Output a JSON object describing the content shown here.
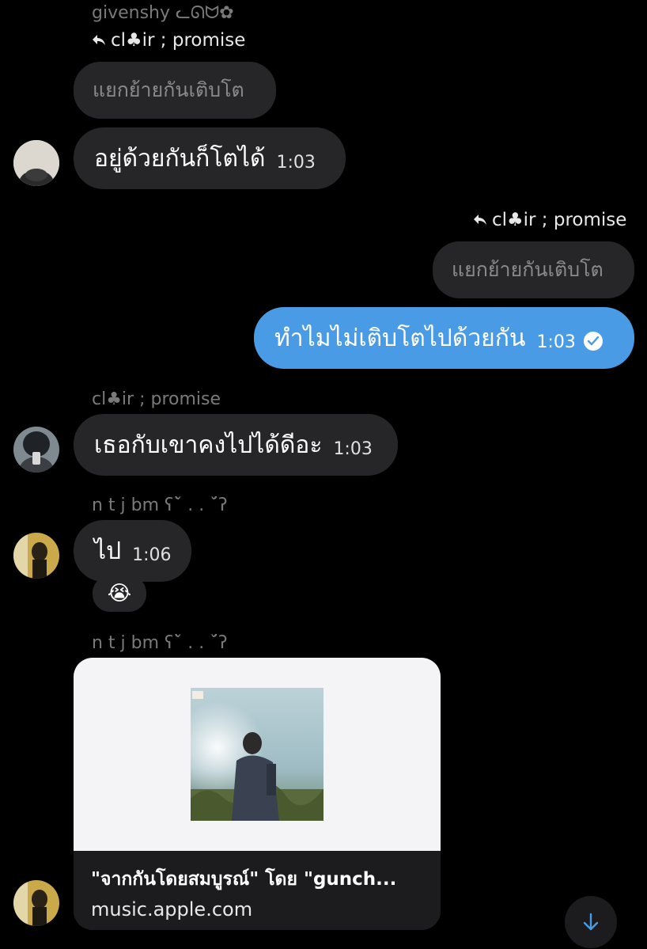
{
  "messages": {
    "m1": {
      "sender": "givenshy ᓚᘏᗢ✿",
      "reply_to": "cl♣ir ; promise",
      "quoted_text": "แยกย้ายกันเติบโต",
      "text": "อยู่ด้วยกันก็โตได้",
      "time": "1:03"
    },
    "m2": {
      "reply_to": "cl♣ir ; promise",
      "quoted_text": "แยกย้ายกันเติบโต",
      "text": "ทำไมไม่เติบโตไปด้วยกัน",
      "time": "1:03",
      "status": "read"
    },
    "m3": {
      "sender": "cl♣ir ; promise",
      "text": "เธอกับเขาคงไปได้ดีอะ",
      "time": "1:03"
    },
    "m4": {
      "sender": "n t j bm ʕ˘̀ . . ˘́ʔ",
      "text": "ไป",
      "time": "1:06",
      "reaction": "😭"
    },
    "m5": {
      "sender": "n t j bm ʕ˘̀ . . ˘́ʔ",
      "link_title": "\"จากกันโดยสมบูรณ์\" โดย \"gunch...",
      "link_domain": "music.apple.com"
    }
  },
  "colors": {
    "background": "#000000",
    "incoming_bubble": "#262628",
    "outgoing_bubble": "#4a9be6",
    "accent": "#4a9be6"
  },
  "icons": {
    "reply": "reply-arrow-icon",
    "read": "read-check-icon",
    "scroll_down": "arrow-down-icon"
  }
}
